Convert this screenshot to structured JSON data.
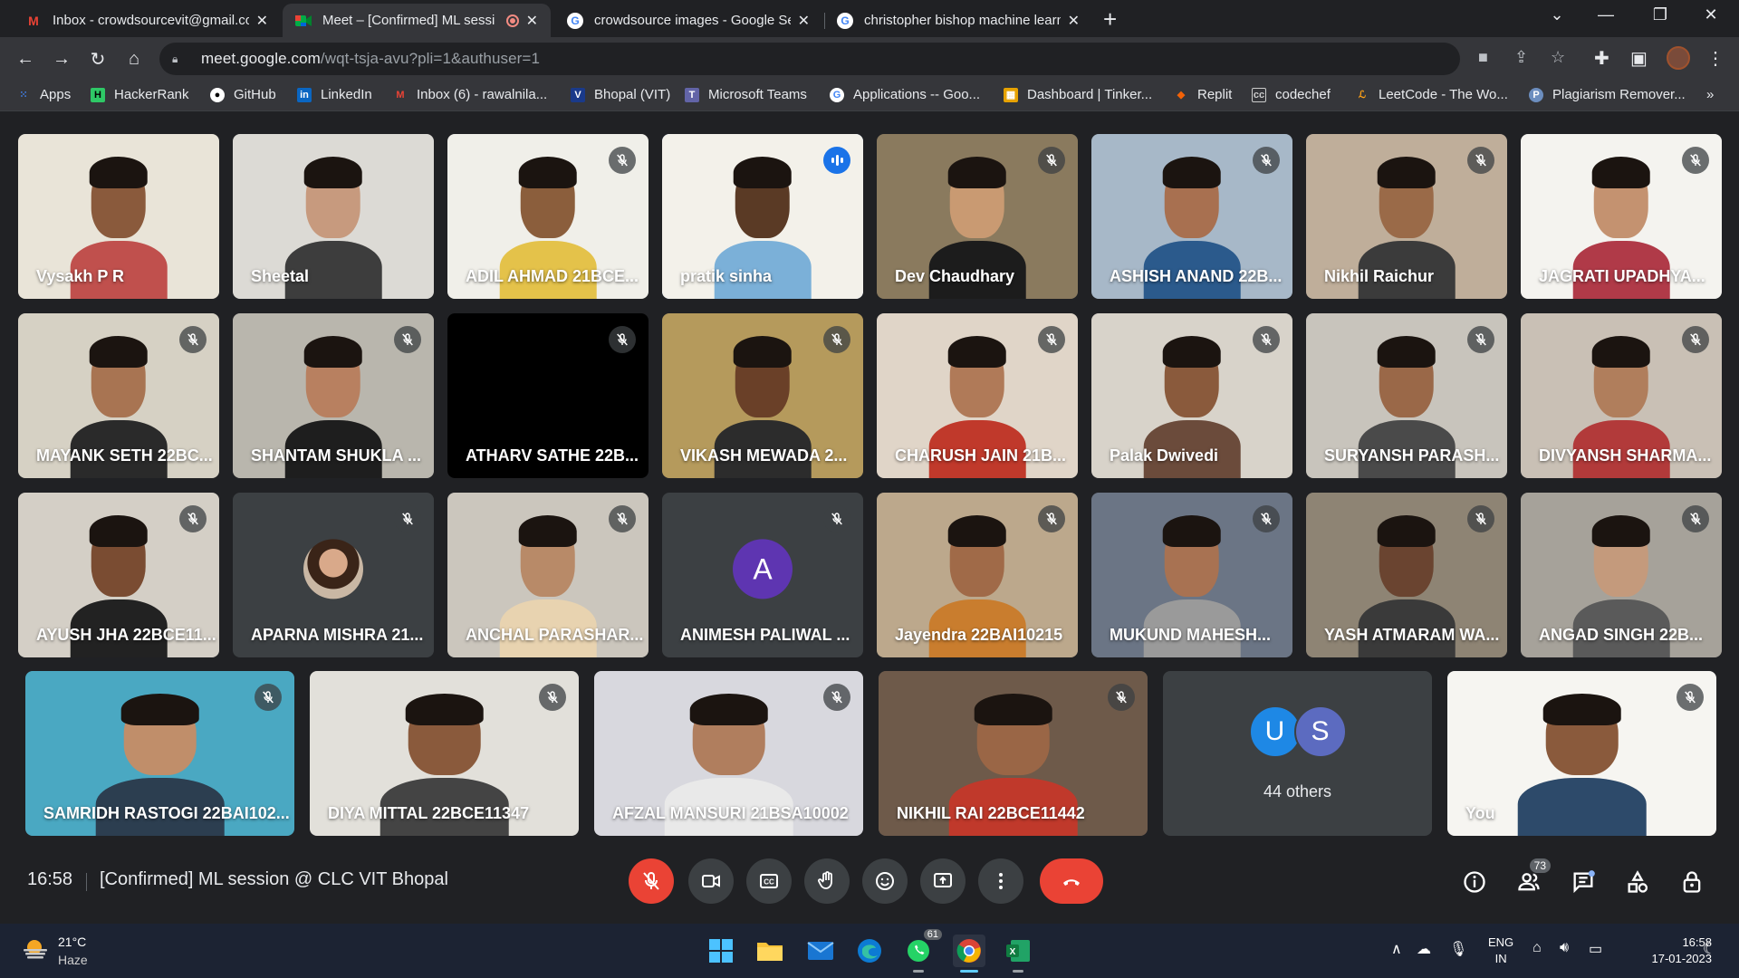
{
  "browser": {
    "tabs": [
      {
        "title": "Inbox - crowdsourcevit@gmail.co",
        "icon": "gmail-icon",
        "active": false
      },
      {
        "title": "Meet – [Confirmed] ML sessi",
        "icon": "meet-icon",
        "active": true
      },
      {
        "title": "crowdsource images - Google Se",
        "icon": "google-icon",
        "active": false
      },
      {
        "title": "christopher bishop machine learn",
        "icon": "google-icon",
        "active": false
      }
    ],
    "address": {
      "host": "meet.google.com",
      "path": "/wqt-tsja-avu?pli=1&authuser=1"
    },
    "bookmarks": [
      {
        "label": "Apps",
        "icon": "apps-grid-icon",
        "color": "#4285f4"
      },
      {
        "label": "HackerRank",
        "icon": "hackerrank-icon",
        "color": "#2ec866"
      },
      {
        "label": "GitHub",
        "icon": "github-icon",
        "color": "#ffffff"
      },
      {
        "label": "LinkedIn",
        "icon": "linkedin-icon",
        "color": "#0a66c2"
      },
      {
        "label": "Inbox (6) - rawalnila...",
        "icon": "gmail-icon",
        "color": "#ea4335"
      },
      {
        "label": "Bhopal (VIT)",
        "icon": "vit-icon",
        "color": "#1a3a8a"
      },
      {
        "label": "Microsoft Teams",
        "icon": "teams-icon",
        "color": "#6264a7"
      },
      {
        "label": "Applications -- Goo...",
        "icon": "google-icon",
        "color": "#ffffff"
      },
      {
        "label": "Dashboard | Tinker...",
        "icon": "tinkercad-icon",
        "color": "#e6a200"
      },
      {
        "label": "Replit",
        "icon": "replit-icon",
        "color": "#f26207"
      },
      {
        "label": "codechef",
        "icon": "codechef-icon",
        "color": "#cccccc"
      },
      {
        "label": "LeetCode - The Wo...",
        "icon": "leetcode-icon",
        "color": "#ffa116"
      },
      {
        "label": "Plagiarism Remover...",
        "icon": "plagiarism-icon",
        "color": "#6c8ebf"
      }
    ]
  },
  "meet": {
    "participants": [
      {
        "name": "Vysakh P R",
        "muted": false,
        "speaking": false,
        "bg": "#e9e4d8",
        "skin": "#8a5a3c",
        "shirt": "#c0504d"
      },
      {
        "name": "Sheetal",
        "muted": false,
        "speaking": false,
        "bg": "#dcdad5",
        "skin": "#c79a7e",
        "shirt": "#3d3d3d"
      },
      {
        "name": "ADIL AHMAD 21BCE...",
        "muted": true,
        "speaking": false,
        "bg": "#f0efe9",
        "skin": "#8b5e3c",
        "shirt": "#e4c24a"
      },
      {
        "name": "pratik sinha",
        "muted": false,
        "speaking": true,
        "bg": "#f3f1ea",
        "skin": "#5a3a25",
        "shirt": "#7bb0d8"
      },
      {
        "name": "Dev Chaudhary",
        "muted": true,
        "speaking": false,
        "bg": "#8a7a5e",
        "skin": "#c99a72",
        "shirt": "#1c1c1c"
      },
      {
        "name": "ASHISH ANAND 22B...",
        "muted": true,
        "speaking": false,
        "bg": "#a7b8c8",
        "skin": "#a87050",
        "shirt": "#2b5a8c"
      },
      {
        "name": "Nikhil Raichur",
        "muted": true,
        "speaking": false,
        "bg": "#bfae9a",
        "skin": "#9a6a48",
        "shirt": "#3b3b3b"
      },
      {
        "name": "JAGRATI UPADHYA...",
        "muted": true,
        "speaking": false,
        "bg": "#f4f3ef",
        "skin": "#c49270",
        "shirt": "#b03a48"
      },
      {
        "name": "MAYANK SETH 22BC...",
        "muted": true,
        "speaking": false,
        "bg": "#d6d1c4",
        "skin": "#a87452",
        "shirt": "#2a2a2a"
      },
      {
        "name": "SHANTAM SHUKLA ...",
        "muted": true,
        "speaking": false,
        "bg": "#b9b6ad",
        "skin": "#b88060",
        "shirt": "#1e1e1e"
      },
      {
        "name": "ATHARV SATHE 22B...",
        "muted": true,
        "speaking": false,
        "bg": "#000000",
        "skin": "#000000",
        "shirt": "#000000"
      },
      {
        "name": "VIKASH MEWADA 2...",
        "muted": true,
        "speaking": false,
        "bg": "#b59a5c",
        "skin": "#6a4028",
        "shirt": "#2c2c2c"
      },
      {
        "name": "CHARUSH JAIN 21B...",
        "muted": true,
        "speaking": false,
        "bg": "#e0d5c8",
        "skin": "#b07a58",
        "shirt": "#c0392b"
      },
      {
        "name": "Palak Dwivedi",
        "muted": true,
        "speaking": false,
        "bg": "#d8d3ca",
        "skin": "#8a5a3c",
        "shirt": "#6b4b3b"
      },
      {
        "name": "SURYANSH PARASH...",
        "muted": true,
        "speaking": false,
        "bg": "#c8c4bc",
        "skin": "#9a6848",
        "shirt": "#4a4a4a"
      },
      {
        "name": "DIVYANSH SHARMA...",
        "muted": true,
        "speaking": false,
        "bg": "#c9c0b5",
        "skin": "#b07e5c",
        "shirt": "#b23a3a"
      },
      {
        "name": "AYUSH JHA 22BCE11...",
        "muted": true,
        "speaking": false,
        "bg": "#d4cfc6",
        "skin": "#7a4c32",
        "shirt": "#222222"
      },
      {
        "name": "APARNA MISHRA 21...",
        "muted": true,
        "speaking": false,
        "avatar": "photo"
      },
      {
        "name": "ANCHAL PARASHAR...",
        "muted": true,
        "speaking": false,
        "bg": "#cbc6bd",
        "skin": "#b88a68",
        "shirt": "#e8d3b0"
      },
      {
        "name": "ANIMESH PALIWAL ...",
        "muted": true,
        "speaking": false,
        "avatar": "letter",
        "letter": "A",
        "avatar_color": "#5e35b1"
      },
      {
        "name": "Jayendra 22BAI10215",
        "muted": true,
        "speaking": false,
        "bg": "#bca88c",
        "skin": "#a06a48",
        "shirt": "#c97d2e"
      },
      {
        "name": "MUKUND MAHESH...",
        "muted": true,
        "speaking": false,
        "bg": "#6b7585",
        "skin": "#a87252",
        "shirt": "#9a9a9a"
      },
      {
        "name": "YASH ATMARAM WA...",
        "muted": true,
        "speaking": false,
        "bg": "#8e8474",
        "skin": "#6a4430",
        "shirt": "#3a3a3a"
      },
      {
        "name": "ANGAD SINGH 22B...",
        "muted": true,
        "speaking": false,
        "bg": "#a6a29a",
        "skin": "#c49a7c",
        "shirt": "#5a5a5a"
      },
      {
        "name": "SAMRIDH RASTOGI 22BAI102...",
        "muted": true,
        "speaking": false,
        "bg": "#4aa8c2",
        "skin": "#c08e6a",
        "shirt": "#2c3e50"
      },
      {
        "name": "DIYA MITTAL 22BCE11347",
        "muted": true,
        "speaking": false,
        "bg": "#e2e0da",
        "skin": "#8a5a3c",
        "shirt": "#444444"
      },
      {
        "name": "AFZAL MANSURI 21BSA10002",
        "muted": true,
        "speaking": false,
        "bg": "#d8d8de",
        "skin": "#b07e5e",
        "shirt": "#e9e9e9"
      },
      {
        "name": "NIKHIL RAI 22BCE11442",
        "muted": true,
        "speaking": false,
        "bg": "#6e5a4a",
        "skin": "#9a6646",
        "shirt": "#c0392b"
      },
      {
        "name": "44 others",
        "tile": "others",
        "avatars": [
          {
            "letter": "U",
            "color": "#1e88e5"
          },
          {
            "letter": "S",
            "color": "#5c6bc0"
          }
        ]
      },
      {
        "name": "You",
        "muted": true,
        "speaking": false,
        "bg": "#f6f5f1",
        "skin": "#8a5a3c",
        "shirt": "#2d4a6a"
      }
    ],
    "time": "16:58",
    "meeting_title": "[Confirmed] ML session @ CLC VIT Bhopal",
    "participant_count": "73",
    "controls": [
      "mic-off",
      "camera",
      "captions",
      "raise-hand",
      "emoji",
      "present",
      "more-options",
      "leave-call"
    ]
  },
  "taskbar": {
    "weather_temp": "21°C",
    "weather_desc": "Haze",
    "whatsapp_badge": "61",
    "lang_top": "ENG",
    "lang_bottom": "IN",
    "clock_time": "16:58",
    "clock_date": "17-01-2023"
  }
}
